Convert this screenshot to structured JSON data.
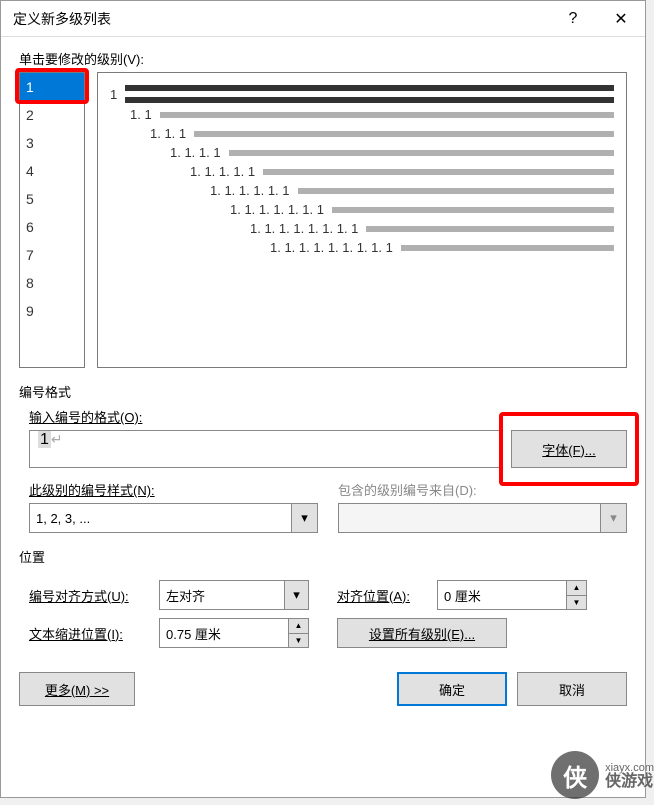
{
  "titlebar": {
    "title": "定义新多级列表",
    "help": "?",
    "close": "✕"
  },
  "levels_label": "单击要修改的级别(V):",
  "levels": [
    "1",
    "2",
    "3",
    "4",
    "5",
    "6",
    "7",
    "8",
    "9"
  ],
  "preview": [
    {
      "num": "1",
      "indent": 0,
      "dark": true
    },
    {
      "num": "1. 1",
      "indent": 20,
      "dark": false
    },
    {
      "num": "1. 1. 1",
      "indent": 40,
      "dark": false
    },
    {
      "num": "1. 1. 1. 1",
      "indent": 60,
      "dark": false
    },
    {
      "num": "1. 1. 1. 1. 1",
      "indent": 80,
      "dark": false
    },
    {
      "num": "1. 1. 1. 1. 1. 1",
      "indent": 100,
      "dark": false
    },
    {
      "num": "1. 1. 1. 1. 1. 1. 1",
      "indent": 120,
      "dark": false
    },
    {
      "num": "1. 1. 1. 1. 1. 1. 1. 1",
      "indent": 140,
      "dark": false
    },
    {
      "num": "1. 1. 1. 1. 1. 1. 1. 1. 1",
      "indent": 160,
      "dark": false
    }
  ],
  "format_section": "编号格式",
  "format_label": "输入编号的格式(O):",
  "format_value": "1",
  "font_btn": "字体(F)...",
  "style_label": "此级别的编号样式(N):",
  "style_value": "1, 2, 3, ...",
  "include_label": "包含的级别编号来自(D):",
  "include_value": "",
  "position_section": "位置",
  "align_label": "编号对齐方式(U):",
  "align_value": "左对齐",
  "align_pos_label": "对齐位置(A):",
  "align_pos_value": "0 厘米",
  "indent_label": "文本缩进位置(I):",
  "indent_value": "0.75 厘米",
  "set_all_btn": "设置所有级别(E)...",
  "more_btn": "更多(M) >>",
  "ok_btn": "确定",
  "cancel_btn": "取消",
  "watermark": {
    "logo": "侠",
    "line1": "xiayx.com",
    "line2": "侠游戏"
  }
}
